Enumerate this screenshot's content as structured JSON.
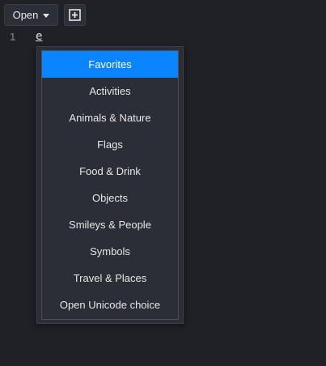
{
  "toolbar": {
    "open_label": "Open",
    "open_icon": "chevron-down-icon",
    "new_icon": "add-tab-icon"
  },
  "editor": {
    "line_number": "1",
    "line_text": "e"
  },
  "menu": {
    "selected_index": 0,
    "items": [
      {
        "label": "Favorites"
      },
      {
        "label": "Activities"
      },
      {
        "label": "Animals & Nature"
      },
      {
        "label": "Flags"
      },
      {
        "label": "Food & Drink"
      },
      {
        "label": "Objects"
      },
      {
        "label": "Smileys & People"
      },
      {
        "label": "Symbols"
      },
      {
        "label": "Travel & Places"
      },
      {
        "label": "Open Unicode choice"
      }
    ]
  },
  "colors": {
    "background": "#1f2127",
    "menu_background": "#2b2e37",
    "selected": "#0a84ff"
  }
}
